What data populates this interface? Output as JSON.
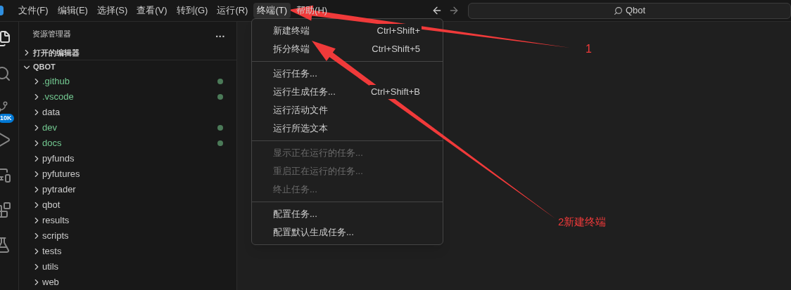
{
  "menubar": {
    "items": [
      {
        "label": "文件(F)",
        "selected": false
      },
      {
        "label": "编辑(E)",
        "selected": false
      },
      {
        "label": "选择(S)",
        "selected": false
      },
      {
        "label": "查看(V)",
        "selected": false
      },
      {
        "label": "转到(G)",
        "selected": false
      },
      {
        "label": "运行(R)",
        "selected": false
      },
      {
        "label": "终端(T)",
        "selected": true
      },
      {
        "label": "帮助(H)",
        "selected": false
      }
    ]
  },
  "search": {
    "value": "Qbot"
  },
  "activity_bar": {
    "badge": "10K"
  },
  "sidebar": {
    "title": "资源管理器",
    "more": "...",
    "sections": [
      {
        "label": "打开的编辑器",
        "expanded": false
      },
      {
        "label": "QBOT",
        "expanded": true
      }
    ],
    "items": [
      {
        "name": ".github",
        "modified": true
      },
      {
        "name": ".vscode",
        "modified": true
      },
      {
        "name": "data",
        "modified": false
      },
      {
        "name": "dev",
        "modified": true
      },
      {
        "name": "docs",
        "modified": true
      },
      {
        "name": "pyfunds",
        "modified": false
      },
      {
        "name": "pyfutures",
        "modified": false
      },
      {
        "name": "pytrader",
        "modified": false
      },
      {
        "name": "qbot",
        "modified": false
      },
      {
        "name": "results",
        "modified": false
      },
      {
        "name": "scripts",
        "modified": false
      },
      {
        "name": "tests",
        "modified": false
      },
      {
        "name": "utils",
        "modified": false
      },
      {
        "name": "web",
        "modified": false
      }
    ]
  },
  "menu": {
    "groups": [
      [
        {
          "label": "新建终端",
          "shortcut": "Ctrl+Shift+",
          "disabled": false
        },
        {
          "label": "拆分终端",
          "shortcut": "Ctrl+Shift+5",
          "disabled": false
        }
      ],
      [
        {
          "label": "运行任务...",
          "disabled": false
        },
        {
          "label": "运行生成任务...",
          "shortcut": "Ctrl+Shift+B",
          "disabled": false
        },
        {
          "label": "运行活动文件",
          "disabled": false
        },
        {
          "label": "运行所选文本",
          "disabled": false
        }
      ],
      [
        {
          "label": "显示正在运行的任务...",
          "disabled": true
        },
        {
          "label": "重启正在运行的任务...",
          "disabled": true
        },
        {
          "label": "终止任务...",
          "disabled": true
        }
      ],
      [
        {
          "label": "配置任务...",
          "disabled": false
        },
        {
          "label": "配置默认生成任务...",
          "disabled": false
        }
      ]
    ]
  },
  "annotations": [
    {
      "label": "1"
    },
    {
      "label": "2新建终端"
    }
  ]
}
